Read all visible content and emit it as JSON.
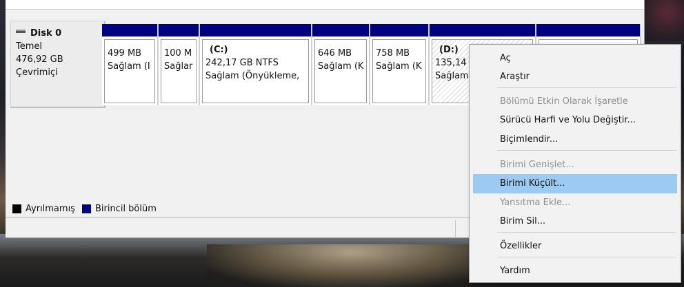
{
  "disk": {
    "name": "Disk 0",
    "type": "Temel",
    "size": "476,92 GB",
    "status": "Çevrimiçi"
  },
  "partitions": [
    {
      "title": "",
      "size": "499 MB",
      "status": "Sağlam (I"
    },
    {
      "title": "",
      "size": "100 M",
      "status": "Sağlar"
    },
    {
      "title": "(C:)",
      "size": "242,17 GB NTFS",
      "status": "Sağlam (Önyükleme,"
    },
    {
      "title": "",
      "size": "646 MB",
      "status": "Sağlam (K"
    },
    {
      "title": "",
      "size": "758 MB",
      "status": "Sağlam (K"
    },
    {
      "title": "(D:)",
      "size": "135,14 (",
      "status": "Sağlam"
    },
    {
      "title": "",
      "size": "",
      "status": ""
    }
  ],
  "legend": {
    "unallocated": "Ayrılmamış",
    "primary": "Birincil bölüm"
  },
  "context_menu": {
    "items": [
      {
        "label": "Aç",
        "enabled": true
      },
      {
        "label": "Araştır",
        "enabled": true
      },
      {
        "label": "Bölümü Etkin Olarak İşaretle",
        "enabled": false
      },
      {
        "label": "Sürücü Harfi ve Yolu Değiştir...",
        "enabled": true
      },
      {
        "label": "Biçimlendir...",
        "enabled": true
      },
      {
        "label": "Birimi Genişlet...",
        "enabled": false
      },
      {
        "label": "Birimi Küçült...",
        "enabled": true,
        "highlighted": true
      },
      {
        "label": "Yansıtma Ekle...",
        "enabled": false
      },
      {
        "label": "Birim Sil...",
        "enabled": true
      },
      {
        "label": "Özellikler",
        "enabled": true
      },
      {
        "label": "Yardım",
        "enabled": true
      }
    ]
  },
  "colors": {
    "primary_partition": "#000080",
    "unallocated": "#000000",
    "menu_highlight": "#9ccaf1"
  }
}
